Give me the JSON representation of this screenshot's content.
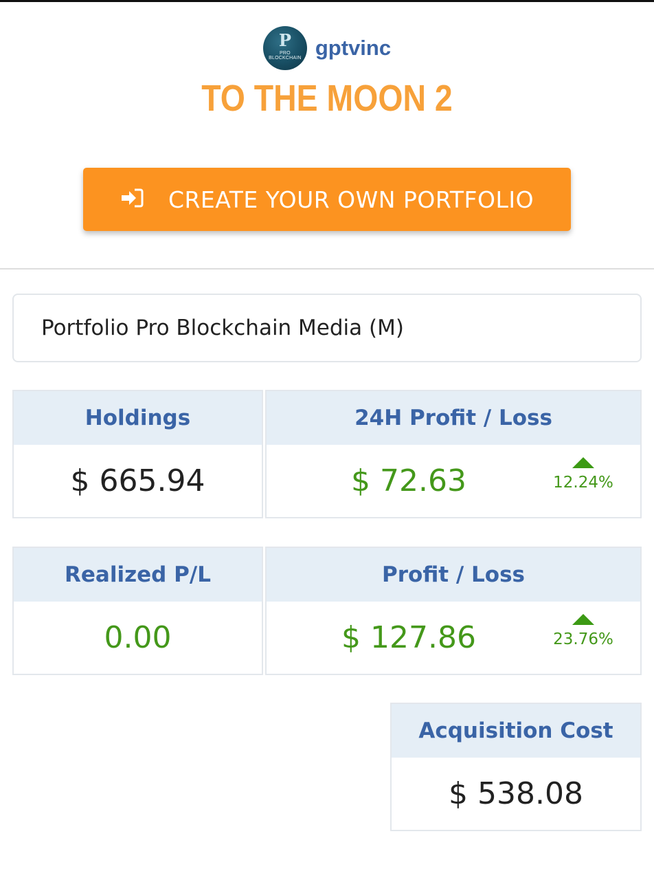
{
  "brand": {
    "avatar_text": "PRO BLOCKCHAIN",
    "avatar_letter": "P",
    "username": "gptvinc"
  },
  "portfolio_title": "TO THE MOON 2",
  "cta": {
    "label": "CREATE YOUR OWN PORTFOLIO",
    "icon": "sign-in-icon"
  },
  "selector": {
    "value": "Portfolio Pro Blockchain Media (M)"
  },
  "stats": {
    "holdings": {
      "label": "Holdings",
      "value": "$ 665.94"
    },
    "pl_24h": {
      "label": "24H Profit / Loss",
      "value": "$ 72.63",
      "percent": "12.24%",
      "trend": "up"
    },
    "realized": {
      "label": "Realized P/L",
      "value": "0.00"
    },
    "profit_loss": {
      "label": "Profit / Loss",
      "value": "$ 127.86",
      "percent": "23.76%",
      "trend": "up"
    },
    "acquisition": {
      "label": "Acquisition Cost",
      "value": "$ 538.08"
    }
  },
  "colors": {
    "accent_orange": "#fc9320",
    "title_orange": "#f7a13a",
    "label_blue": "#3a64a6",
    "header_bg": "#e5eef6",
    "positive_green": "#44981a"
  }
}
